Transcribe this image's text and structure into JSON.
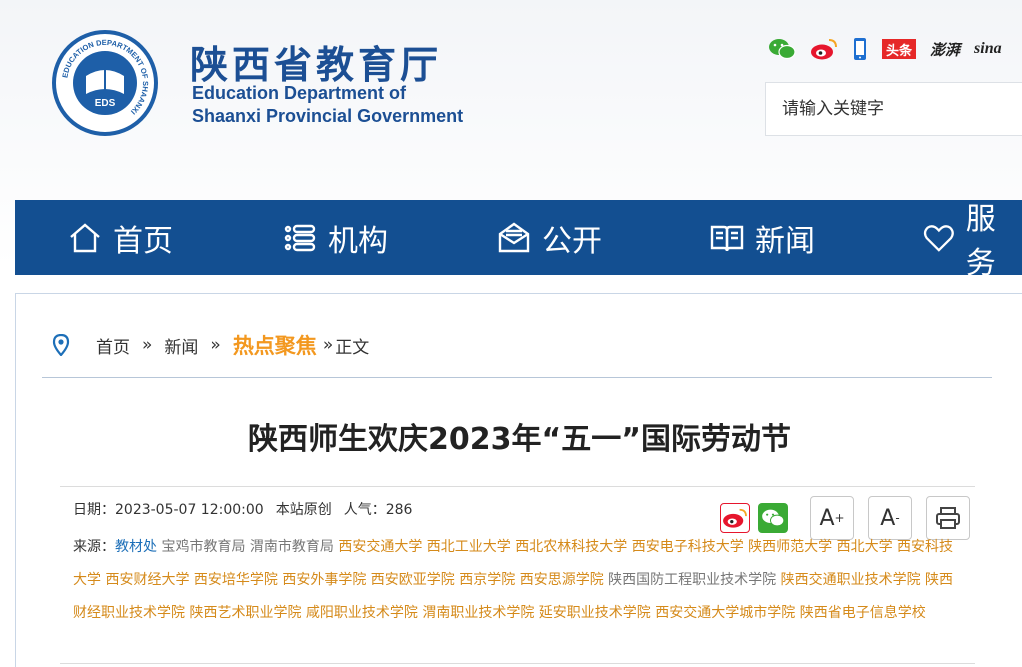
{
  "header": {
    "site_name_cn": "陕西省教育厅",
    "site_name_en_line1": "Education Department of",
    "site_name_en_line2": "Shaanxi Provincial Government",
    "logo_ring_text": "EDUCATION DEPARTMENT OF SHAANXI",
    "logo_center": "EDS",
    "logo_bottom": "陕西省教育厅",
    "social": {
      "toutiao": "头条",
      "pengpai": "澎湃",
      "sina": "sina"
    },
    "search_placeholder": "请输入关键字"
  },
  "nav": {
    "items": [
      {
        "label": "首页",
        "icon": "home-icon"
      },
      {
        "label": "机构",
        "icon": "list-icon"
      },
      {
        "label": "公开",
        "icon": "mail-icon"
      },
      {
        "label": "新闻",
        "icon": "book-icon"
      },
      {
        "label": "服务",
        "icon": "heart-icon"
      }
    ]
  },
  "breadcrumb": {
    "home": "首页",
    "news": "新闻",
    "hot": "热点聚焦",
    "current": "正文",
    "sep": "»"
  },
  "article": {
    "title": "陕西师生欢庆2023年“五一”国际劳动节",
    "date": "日期：2023-05-07 12:00:00",
    "origin": "本站原创",
    "views": "人气：286",
    "source_label": "来源：",
    "source_main": "教材处",
    "source_gray": "宝鸡市教育局  渭南市教育局",
    "source_orange": "西安交通大学  西北工业大学  西北农林科技大学  西安电子科技大学  陕西师范大学  西北大学  西安科技大学  西安财经大学  西安培华学院  西安外事学院  西安欧亚学院  西京学院  西安思源学院",
    "source_gray2": "陕西国防工程职业技术学院",
    "source_orange2": "陕西交通职业技术学院  陕西财经职业技术学院  陕西艺术职业学院  咸阳职业技术学院  渭南职业技术学院  延安职业技术学院  西安交通大学城市学院  陕西省电子信息学校"
  },
  "tools": {
    "font_up": "A",
    "font_down": "A"
  },
  "colors": {
    "nav_bg": "#134f91",
    "brand": "#1c4f94",
    "hot": "#f3981f"
  }
}
